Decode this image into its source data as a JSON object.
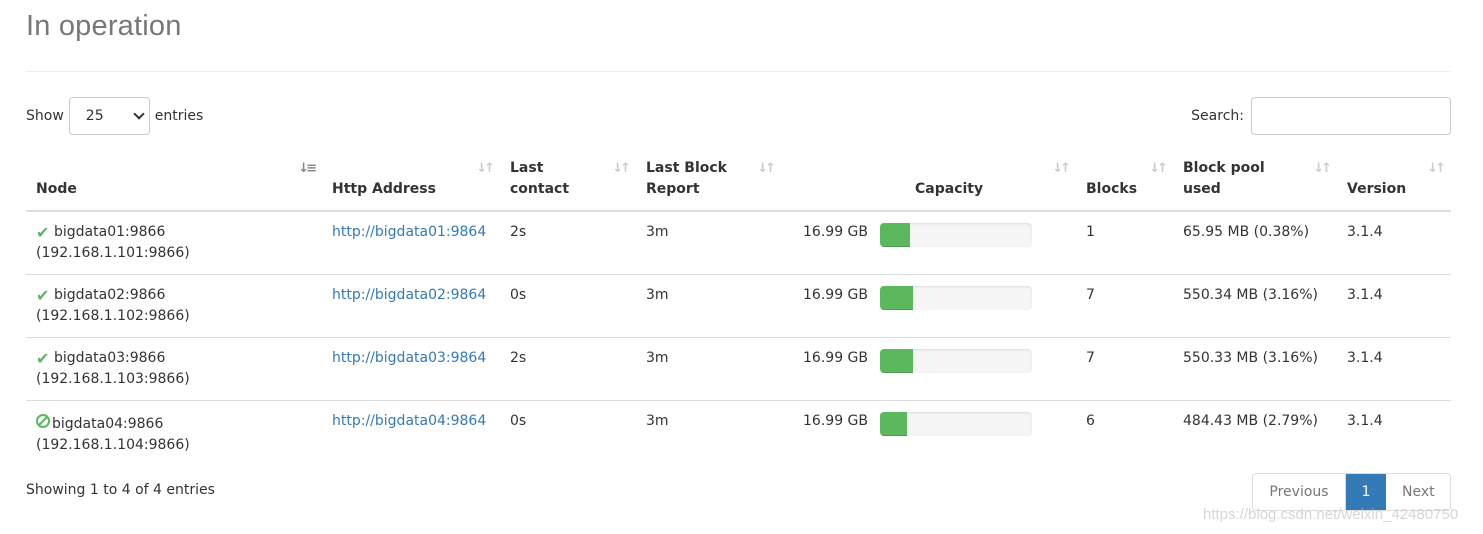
{
  "page": {
    "title": "In operation"
  },
  "length_control": {
    "show_label": "Show",
    "selected": "25",
    "entries_label": "entries"
  },
  "search": {
    "label": "Search:",
    "value": "",
    "placeholder": ""
  },
  "table": {
    "columns": [
      {
        "label": "Node",
        "sort": "ascending"
      },
      {
        "label": "Http Address",
        "sort": "none"
      },
      {
        "label": "Last contact",
        "sort": "none"
      },
      {
        "label": "Last Block Report",
        "sort": "none"
      },
      {
        "label": "Capacity",
        "sort": "none"
      },
      {
        "label": "Blocks",
        "sort": "none"
      },
      {
        "label": "Block pool used",
        "sort": "none"
      },
      {
        "label": "Version",
        "sort": "none"
      }
    ],
    "sort_icon_glyph": "⇅",
    "rows": [
      {
        "status_icon": "check-icon",
        "node": "bigdata01:9866",
        "node_ip": "(192.168.1.101:9866)",
        "http_address": "http://bigdata01:9864",
        "last_contact": "2s",
        "last_block_report": "3m",
        "capacity": "16.99 GB",
        "capacity_used_pct": 20,
        "blocks": "1",
        "block_pool_used": "65.95 MB (0.38%)",
        "version": "3.1.4"
      },
      {
        "status_icon": "check-icon",
        "node": "bigdata02:9866",
        "node_ip": "(192.168.1.102:9866)",
        "http_address": "http://bigdata02:9864",
        "last_contact": "0s",
        "last_block_report": "3m",
        "capacity": "16.99 GB",
        "capacity_used_pct": 22,
        "blocks": "7",
        "block_pool_used": "550.34 MB (3.16%)",
        "version": "3.1.4"
      },
      {
        "status_icon": "check-icon",
        "node": "bigdata03:9866",
        "node_ip": "(192.168.1.103:9866)",
        "http_address": "http://bigdata03:9864",
        "last_contact": "2s",
        "last_block_report": "3m",
        "capacity": "16.99 GB",
        "capacity_used_pct": 22,
        "blocks": "7",
        "block_pool_used": "550.33 MB (3.16%)",
        "version": "3.1.4"
      },
      {
        "status_icon": "decommissioned-icon",
        "node": "bigdata04:9866",
        "node_ip": "(192.168.1.104:9866)",
        "http_address": "http://bigdata04:9864",
        "last_contact": "0s",
        "last_block_report": "3m",
        "capacity": "16.99 GB",
        "capacity_used_pct": 18,
        "blocks": "6",
        "block_pool_used": "484.43 MB (2.79%)",
        "version": "3.1.4"
      }
    ]
  },
  "footer": {
    "info": "Showing 1 to 4 of 4 entries",
    "pagination": {
      "previous": "Previous",
      "current": "1",
      "next": "Next"
    }
  },
  "watermark": "https://blog.csdn.net/weixin_42480750",
  "colors": {
    "link": "#337ab7",
    "success": "#5cb85c",
    "active_page": "#337ab7"
  }
}
